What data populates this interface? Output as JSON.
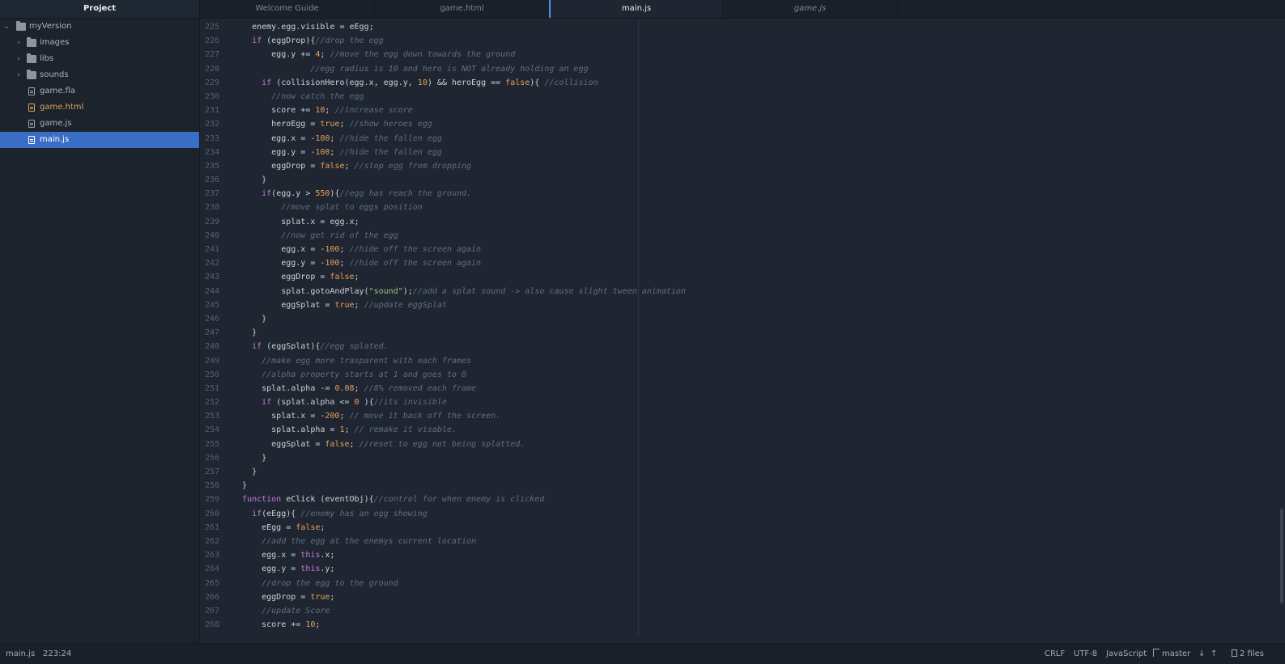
{
  "sidebar": {
    "title": "Project",
    "root": "myVersion",
    "folders": [
      "images",
      "libs",
      "sounds"
    ],
    "files": [
      "game.fla",
      "game.html",
      "game.js",
      "main.js"
    ]
  },
  "tabs": [
    "Welcome Guide",
    "game.html",
    "main.js",
    "game.js"
  ],
  "code": {
    "line_numbers": [
      "225",
      "226",
      "227",
      "228",
      "229",
      "230",
      "231",
      "232",
      "233",
      "234",
      "235",
      "236",
      "237",
      "238",
      "239",
      "240",
      "241",
      "242",
      "243",
      "244",
      "245",
      "246",
      "247",
      "248",
      "249",
      "250",
      "251",
      "252",
      "253",
      "254",
      "255",
      "256",
      "257",
      "258",
      "259",
      "260",
      "261",
      "262",
      "263",
      "264",
      "265",
      "266",
      "267",
      "268"
    ],
    "lines": [
      [
        [
          "t",
          "    enemy.egg.visible = eEgg;"
        ]
      ],
      [
        [
          "k",
          "    if "
        ],
        [
          "t",
          "(eggDrop){"
        ],
        [
          "c",
          "//drop the egg"
        ]
      ],
      [
        [
          "t",
          "        egg.y += "
        ],
        [
          "n",
          "4"
        ],
        [
          "t",
          "; "
        ],
        [
          "c",
          "//move the egg down towards the ground"
        ]
      ],
      [
        [
          "c",
          "                //egg radius is 10 and hero is NOT already holding an egg"
        ]
      ],
      [
        [
          "k",
          "      if "
        ],
        [
          "t",
          "(collisionHero(egg.x, egg.y, "
        ],
        [
          "n",
          "10"
        ],
        [
          "t",
          ") && heroEgg == "
        ],
        [
          "b",
          "false"
        ],
        [
          "t",
          "){ "
        ],
        [
          "c",
          "//collision"
        ]
      ],
      [
        [
          "c",
          "        //now catch the egg"
        ]
      ],
      [
        [
          "t",
          "        score += "
        ],
        [
          "n",
          "10"
        ],
        [
          "t",
          "; "
        ],
        [
          "c",
          "//increase score"
        ]
      ],
      [
        [
          "t",
          "        heroEgg = "
        ],
        [
          "b",
          "true"
        ],
        [
          "t",
          "; "
        ],
        [
          "c",
          "//show heroes egg"
        ]
      ],
      [
        [
          "t",
          "        egg.x = -"
        ],
        [
          "n",
          "100"
        ],
        [
          "t",
          "; "
        ],
        [
          "c",
          "//hide the fallen egg"
        ]
      ],
      [
        [
          "t",
          "        egg.y = -"
        ],
        [
          "n",
          "100"
        ],
        [
          "t",
          "; "
        ],
        [
          "c",
          "//hide the fallen egg"
        ]
      ],
      [
        [
          "t",
          "        eggDrop = "
        ],
        [
          "b",
          "false"
        ],
        [
          "t",
          "; "
        ],
        [
          "c",
          "//stop egg from dropping"
        ]
      ],
      [
        [
          "t",
          "      }"
        ]
      ],
      [
        [
          "k",
          "      if"
        ],
        [
          "t",
          "(egg.y > "
        ],
        [
          "n",
          "550"
        ],
        [
          "t",
          "){"
        ],
        [
          "c",
          "//egg has reach the ground."
        ]
      ],
      [
        [
          "c",
          "          //move splat to eggs position"
        ]
      ],
      [
        [
          "t",
          "          splat.x = egg.x;"
        ]
      ],
      [
        [
          "c",
          "          //now get rid of the egg"
        ]
      ],
      [
        [
          "t",
          "          egg.x = -"
        ],
        [
          "n",
          "100"
        ],
        [
          "t",
          "; "
        ],
        [
          "c",
          "//hide off the screen again"
        ]
      ],
      [
        [
          "t",
          "          egg.y = -"
        ],
        [
          "n",
          "100"
        ],
        [
          "t",
          "; "
        ],
        [
          "c",
          "//hide off the screen again"
        ]
      ],
      [
        [
          "t",
          "          eggDrop = "
        ],
        [
          "b",
          "false"
        ],
        [
          "t",
          ";"
        ]
      ],
      [
        [
          "t",
          "          splat.gotoAndPlay("
        ],
        [
          "s",
          "\"sound\""
        ],
        [
          "t",
          ");"
        ],
        [
          "c",
          "//add a splat sound -> also cause slight tween animation"
        ]
      ],
      [
        [
          "t",
          "          eggSplat = "
        ],
        [
          "b",
          "true"
        ],
        [
          "t",
          "; "
        ],
        [
          "c",
          "//update eggSplat"
        ]
      ],
      [
        [
          "t",
          "      }"
        ]
      ],
      [
        [
          "t",
          "    }"
        ]
      ],
      [
        [
          "k",
          "    if "
        ],
        [
          "t",
          "(eggSplat){"
        ],
        [
          "c",
          "//egg splated."
        ]
      ],
      [
        [
          "c",
          "      //make egg more trasparent with each frames"
        ]
      ],
      [
        [
          "c",
          "      //alpha property starts at 1 and goes to 0"
        ]
      ],
      [
        [
          "t",
          "      splat.alpha -= "
        ],
        [
          "n",
          "0.08"
        ],
        [
          "t",
          "; "
        ],
        [
          "c",
          "//8% removed each frame"
        ]
      ],
      [
        [
          "k",
          "      if "
        ],
        [
          "t",
          "(splat.alpha <= "
        ],
        [
          "n",
          "0"
        ],
        [
          "t",
          " ){"
        ],
        [
          "c",
          "//its invisible"
        ]
      ],
      [
        [
          "t",
          "        splat.x = -"
        ],
        [
          "n",
          "200"
        ],
        [
          "t",
          "; "
        ],
        [
          "c",
          "// move it back off the screen."
        ]
      ],
      [
        [
          "t",
          "        splat.alpha = "
        ],
        [
          "n",
          "1"
        ],
        [
          "t",
          "; "
        ],
        [
          "c",
          "// remake it visable."
        ]
      ],
      [
        [
          "t",
          "        eggSplat = "
        ],
        [
          "b",
          "false"
        ],
        [
          "t",
          "; "
        ],
        [
          "c",
          "//reset to egg not being splatted."
        ]
      ],
      [
        [
          "t",
          "      }"
        ]
      ],
      [
        [
          "t",
          "    }"
        ]
      ],
      [
        [
          "t",
          "  }"
        ]
      ],
      [
        [
          "k",
          "  function "
        ],
        [
          "f",
          "eClick "
        ],
        [
          "t",
          "(eventObj){"
        ],
        [
          "c",
          "//control for when enemy is clicked"
        ]
      ],
      [
        [
          "k",
          "    if"
        ],
        [
          "t",
          "(eEgg){ "
        ],
        [
          "c",
          "//enemy has an egg showing"
        ]
      ],
      [
        [
          "t",
          "      eEgg = "
        ],
        [
          "b",
          "false"
        ],
        [
          "t",
          ";"
        ]
      ],
      [
        [
          "c",
          "      //add the egg at the enemys current location"
        ]
      ],
      [
        [
          "t",
          "      egg.x = "
        ],
        [
          "k",
          "this"
        ],
        [
          "t",
          ".x;"
        ]
      ],
      [
        [
          "t",
          "      egg.y = "
        ],
        [
          "k",
          "this"
        ],
        [
          "t",
          ".y;"
        ]
      ],
      [
        [
          "c",
          "      //drop the egg to the ground"
        ]
      ],
      [
        [
          "t",
          "      eggDrop = "
        ],
        [
          "b",
          "true"
        ],
        [
          "t",
          ";"
        ]
      ],
      [
        [
          "c",
          "      //update Score"
        ]
      ],
      [
        [
          "t",
          "      score += "
        ],
        [
          "n",
          "10"
        ],
        [
          "t",
          ";"
        ]
      ]
    ]
  },
  "status": {
    "file": "main.js",
    "cursor": "223:24",
    "line_ending": "CRLF",
    "encoding": "UTF-8",
    "grammar": "JavaScript",
    "branch": "master",
    "files": "2 files"
  },
  "colors": {
    "background": "#1f2631",
    "selection": "#3a6ec4",
    "keyword": "#c678dd",
    "comment": "#5c6f85",
    "number": "#e5a05c",
    "string": "#98c379",
    "modified": "#d8a657"
  }
}
